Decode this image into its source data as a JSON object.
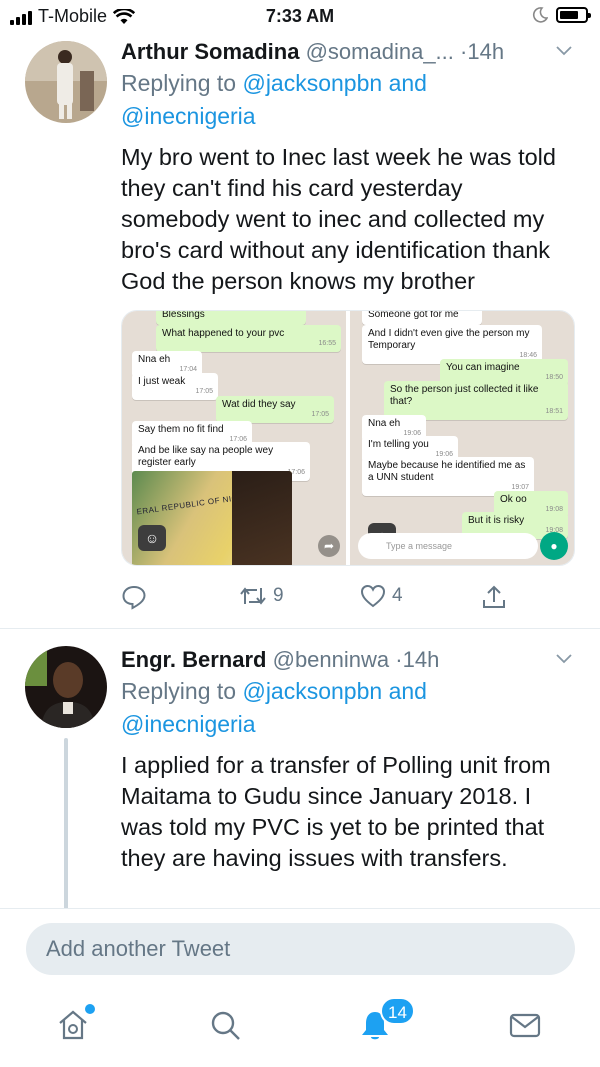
{
  "status_bar": {
    "carrier": "T-Mobile",
    "time": "7:33 AM"
  },
  "tweets": [
    {
      "name": "Arthur Somadina",
      "handle": "@somadina_...",
      "separator": "·",
      "time": "14h",
      "reply_prefix": "Replying to",
      "reply_to_line1": "@jacksonpbn and",
      "reply_to_line2": "@inecnigeria",
      "text": "My bro went to Inec last week he was told they can't find his card yesterday somebody went to inec and collected my bro's card without any identification thank God the person knows my brother",
      "retweet_count": "9",
      "like_count": "4"
    },
    {
      "name": "Engr. Bernard",
      "handle": "@benninwa",
      "separator": "·",
      "time": "14h",
      "reply_prefix": "Replying to",
      "reply_to_line1": "@jacksonpbn and",
      "reply_to_line2": "@inecnigeria",
      "text": "I applied for a transfer of Polling unit from Maitama to Gudu since January 2018. I was told my PVC is yet to be printed that they are having issues with transfers."
    }
  ],
  "media": {
    "left_chat": [
      {
        "text": "Blessings",
        "time": ""
      },
      {
        "text": "What happened to your pvc",
        "time": "16:55"
      },
      {
        "text": "Nna eh",
        "time": "17:04"
      },
      {
        "text": "I just weak",
        "time": "17:05"
      },
      {
        "text": "Wat did they say",
        "time": "17:05"
      },
      {
        "text": "Say them no fit find",
        "time": "17:06"
      },
      {
        "text": "And be like say na people wey register early",
        "time": "17:06"
      }
    ],
    "card_text": "ERAL REPUBLIC OF NIGERIA",
    "right_chat": [
      {
        "text": "Someone got for me",
        "time": "18:46"
      },
      {
        "text": "And I didn't even give the person my Temporary",
        "time": "18:46"
      },
      {
        "text": "You can imagine",
        "time": "18:50"
      },
      {
        "text": "So the person just collected it like that?",
        "time": "18:51"
      },
      {
        "text": "Nna eh",
        "time": "19:06"
      },
      {
        "text": "I'm telling you",
        "time": "19:06"
      },
      {
        "text": "Maybe because he identified me as a UNN student",
        "time": "19:07"
      },
      {
        "text": "Ok oo",
        "time": "19:08"
      },
      {
        "text": "But it is risky",
        "time": "19:08"
      }
    ],
    "input_placeholder": "Type a message"
  },
  "compose": {
    "placeholder": "Add another Tweet"
  },
  "tabbar": {
    "notifications_badge": "14"
  },
  "colors": {
    "link": "#1b95e0",
    "accent": "#1da1f2",
    "muted": "#657786",
    "divider": "#e6ecf0"
  }
}
